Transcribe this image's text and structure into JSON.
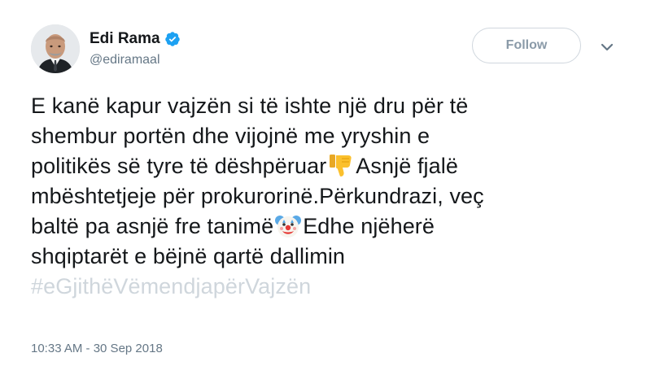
{
  "author": {
    "display_name": "Edi Rama",
    "handle": "@ediramaal",
    "verified": true
  },
  "actions": {
    "follow_label": "Follow",
    "more_icon": "chevron-down-icon"
  },
  "tweet": {
    "lines": {
      "l1": "E kanë kapur vajzën si të ishte një dru për të",
      "l2": "shembur portën dhe vijojnë me yryshin e",
      "l3_text": "politikës së tyre të dëshpëruar",
      "l3_after": "Asnjë fjalë",
      "l4": "mbështetjeje për prokurorinë.Përkundrazi, veç",
      "l5_text": "baltë pa asnjë fre tanimë",
      "l5_after": "Edhe njëherë",
      "l6": "shqiptarët e bëjnë qartë dallimin"
    },
    "hashtag": "#eGjithëVëmendjapërVajzën",
    "emojis": [
      "thumbs-down-icon",
      "clown-face-icon"
    ]
  },
  "meta": {
    "timestamp": "10:33 AM - 30 Sep 2018"
  },
  "colors": {
    "text": "#14171a",
    "secondary": "#657786",
    "verified_blue": "#1da1f2",
    "hashtag": "#cfd6dc"
  }
}
